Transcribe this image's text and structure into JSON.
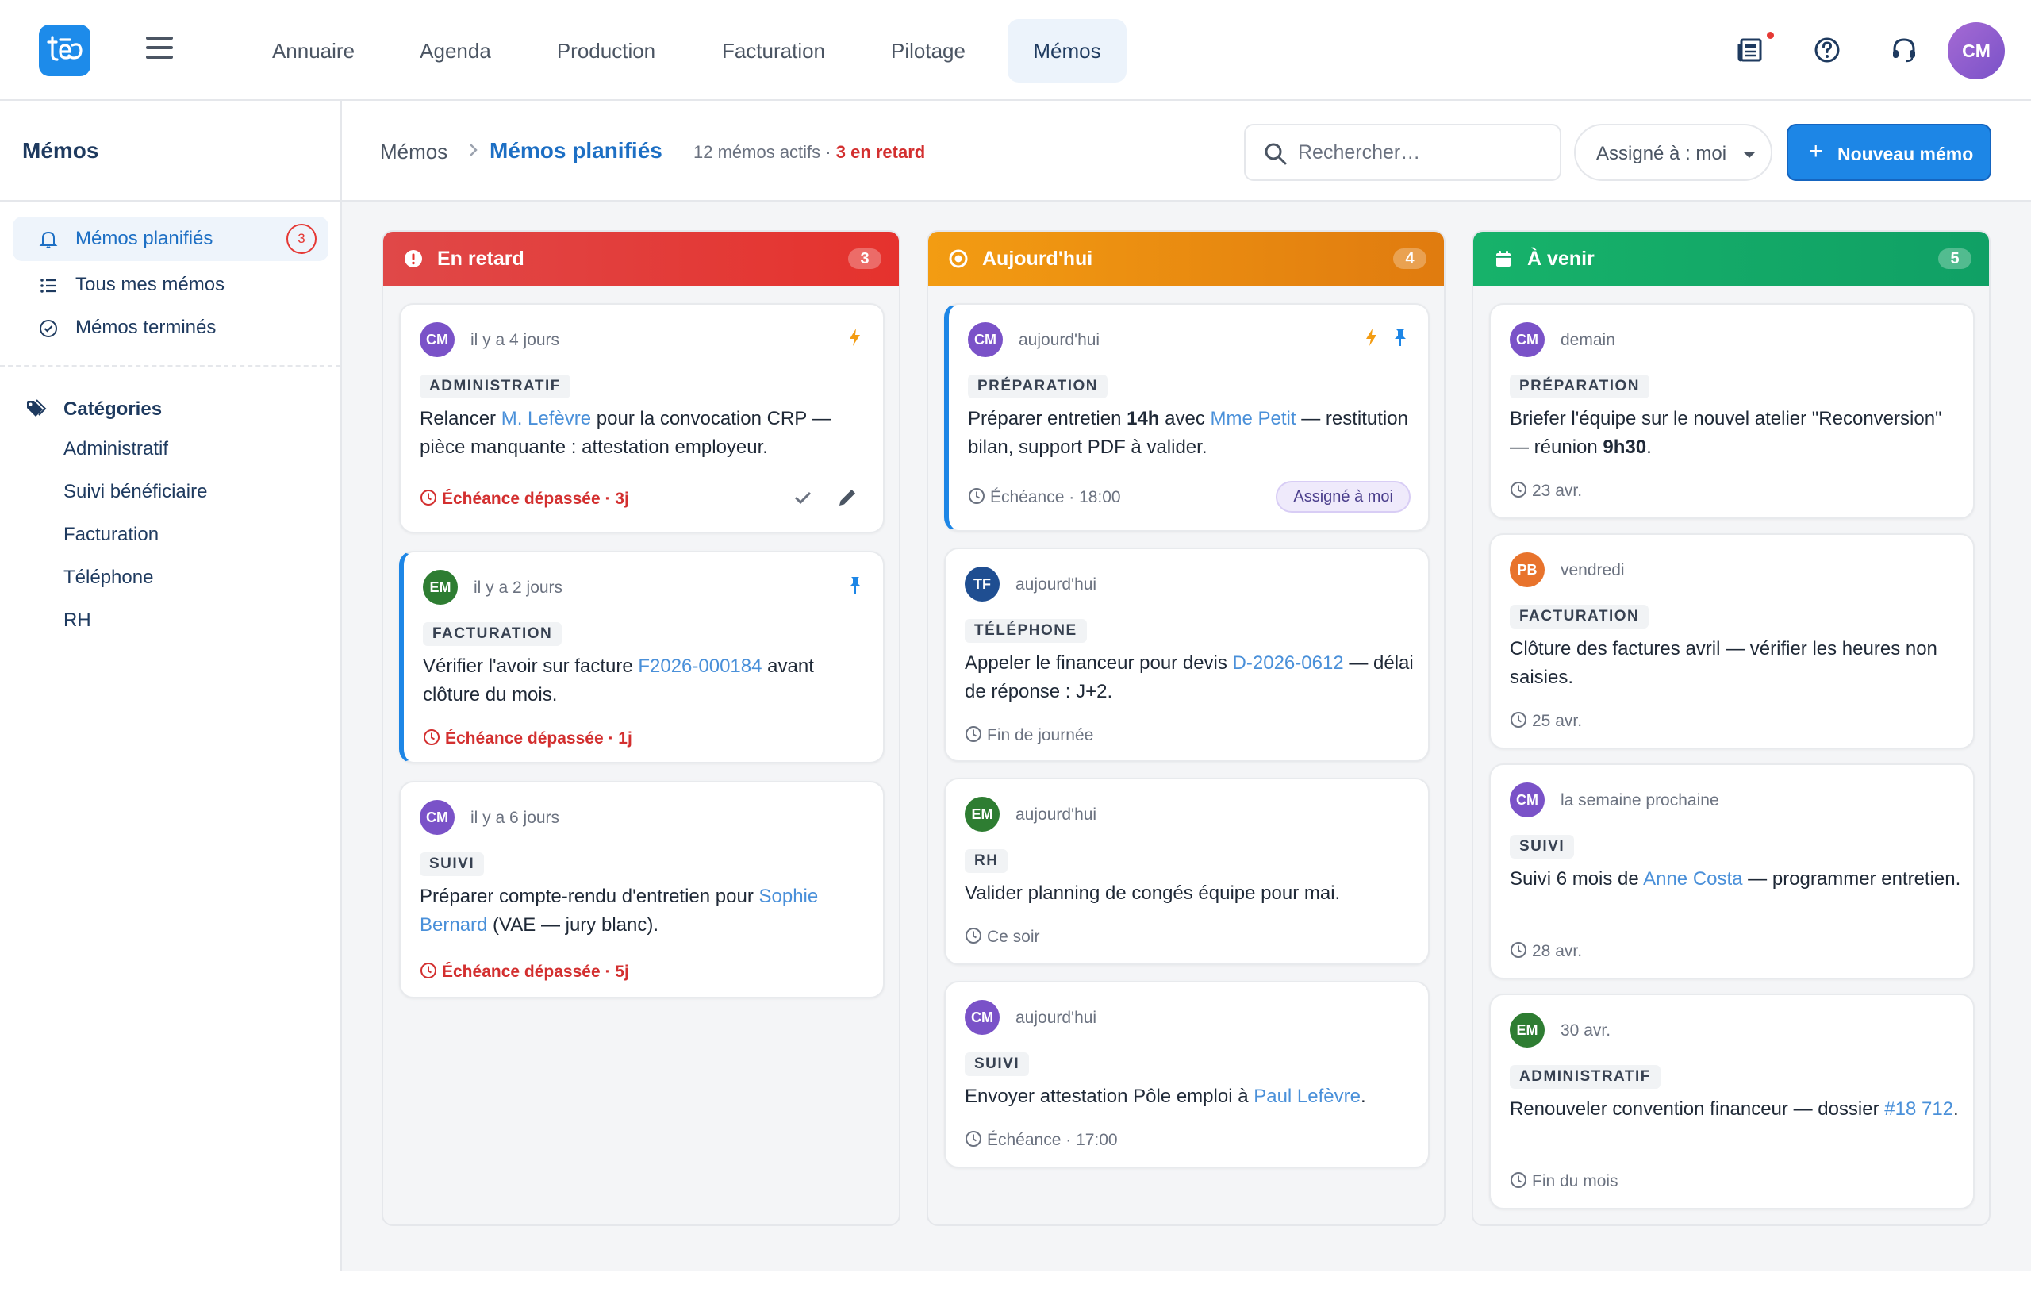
{
  "app": {
    "logo_text": "tēo"
  },
  "nav": {
    "items": [
      {
        "label": "Annuaire"
      },
      {
        "label": "Agenda"
      },
      {
        "label": "Production"
      },
      {
        "label": "Facturation"
      },
      {
        "label": "Pilotage"
      },
      {
        "label": "Mémos",
        "active": true
      }
    ]
  },
  "topbar": {
    "icons": [
      "news-icon",
      "help-icon",
      "support-headset-icon"
    ],
    "user_initials": "CM"
  },
  "sidebar": {
    "title": "Mémos",
    "items": [
      {
        "label": "Mémos planifiés",
        "icon": "bell-icon",
        "badge": "3",
        "active": true
      },
      {
        "label": "Tous mes mémos",
        "icon": "list-icon"
      },
      {
        "label": "Mémos terminés",
        "icon": "check-circle-icon"
      }
    ],
    "categories_title": "Catégories",
    "categories": [
      "Administratif",
      "Suivi bénéficiaire",
      "Facturation",
      "Téléphone",
      "RH"
    ]
  },
  "header": {
    "breadcrumb_root": "Mémos",
    "breadcrumb_current": "Mémos planifiés",
    "active_count": "12 mémos actifs ·",
    "late_count": "3 en retard",
    "search_placeholder": "Rechercher…",
    "assign_filter": "Assigné à : moi",
    "new_button": "Nouveau mémo"
  },
  "columns": [
    {
      "title": "En retard",
      "count": "3",
      "color_from": "#e04848",
      "color_to": "#e5322d",
      "cards": [
        {
          "initials": "CM",
          "when": "il y a 4 jours",
          "tag": "ADMINISTRATIF",
          "text_parts": [
            "Relancer ",
            "M. Lefèvre",
            " pour la convocation CRP — pièce manquante : attestation employeur."
          ],
          "due": "Échéance dépassée · 3j",
          "late": true,
          "flags": [
            "lightning"
          ],
          "actions": [
            "check",
            "edit"
          ]
        },
        {
          "initials": "EM",
          "when": "il y a 2 jours",
          "tag": "FACTURATION",
          "text_parts": [
            "Vérifier l'avoir sur facture ",
            "F2026-000184",
            " avant clôture du mois."
          ],
          "due": "Échéance dépassée · 1j",
          "late": true,
          "flags": [
            "pin"
          ],
          "pinned": true
        },
        {
          "initials": "CM",
          "when": "il y a 6 jours",
          "tag": "SUIVI",
          "text_parts": [
            "Préparer compte-rendu d'entretien pour ",
            "Sophie Bernard",
            " (VAE — jury blanc)."
          ],
          "due": "Échéance dépassée · 5j",
          "late": true
        }
      ]
    },
    {
      "title": "Aujourd'hui",
      "count": "4",
      "color_from": "#f39c12",
      "color_to": "#e07b0f",
      "cards": [
        {
          "initials": "CM",
          "when": "aujourd'hui",
          "tag": "PRÉPARATION",
          "text_parts": [
            "Préparer entretien ",
            "14h",
            " avec ",
            "Mme Petit",
            " — restitution bilan, support PDF à valider."
          ],
          "due": "Échéance · 18:00",
          "assigned": "Assigné à moi",
          "flags": [
            "lightning",
            "pin"
          ],
          "pinned": true
        },
        {
          "initials": "TF",
          "when": "aujourd'hui",
          "tag": "TÉLÉPHONE",
          "text_parts": [
            "Appeler le financeur pour devis ",
            "D-2026-0612",
            " — délai de réponse : J+2."
          ],
          "due": "Fin de journée"
        },
        {
          "initials": "EM",
          "when": "aujourd'hui",
          "tag": "RH",
          "text_parts": [
            "Valider planning de congés équipe pour mai."
          ],
          "due": "Ce soir"
        },
        {
          "initials": "CM",
          "when": "aujourd'hui",
          "tag": "SUIVI",
          "text_parts": [
            "Envoyer attestation Pôle emploi à ",
            "Paul Lefèvre",
            "."
          ],
          "due": "Échéance · 17:00"
        }
      ]
    },
    {
      "title": "À venir",
      "count": "5",
      "color_from": "#17b26a",
      "color_to": "#10a065",
      "cards": [
        {
          "initials": "CM",
          "when": "demain",
          "tag": "PRÉPARATION",
          "text_parts": [
            "Briefer l'équipe sur le nouvel atelier \"Reconversion\" — réunion ",
            "9h30",
            "."
          ],
          "due": "23 avr."
        },
        {
          "initials": "PB",
          "when": "vendredi",
          "tag": "FACTURATION",
          "text_parts": [
            "Clôture des factures avril — vérifier les heures non saisies."
          ],
          "due": "25 avr."
        },
        {
          "initials": "CM",
          "when": "la semaine prochaine",
          "tag": "SUIVI",
          "text_parts": [
            "Suivi 6 mois de ",
            "Anne Costa",
            " — programmer entretien."
          ],
          "due": "28 avr."
        },
        {
          "initials": "EM",
          "when": "30 avr.",
          "tag": "ADMINISTRATIF",
          "text_parts": [
            "Renouveler convention financeur — dossier ",
            "#18 712",
            "."
          ],
          "due": "Fin du mois"
        }
      ]
    }
  ]
}
